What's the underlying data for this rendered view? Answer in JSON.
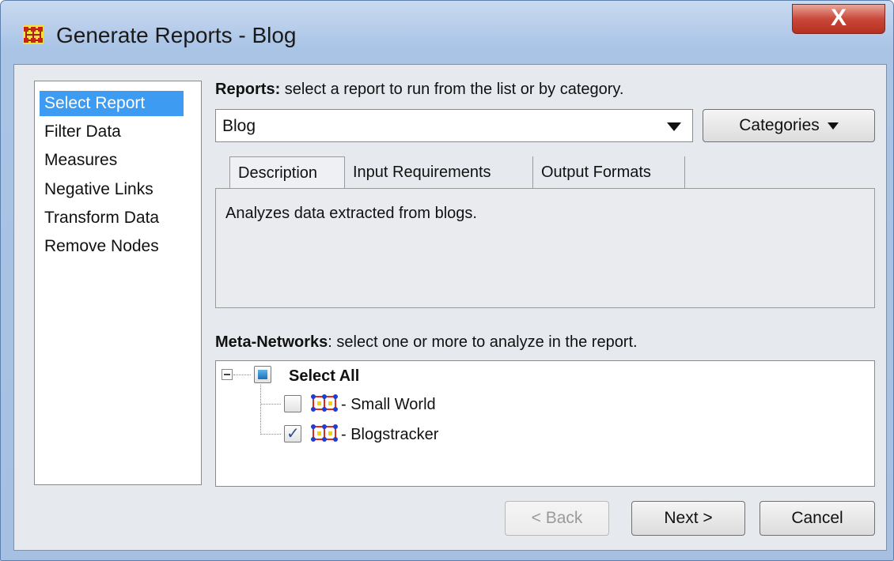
{
  "window": {
    "title": "Generate Reports - Blog",
    "app_icon": "network-grid-icon",
    "close_glyph": "X"
  },
  "nav": {
    "items": [
      {
        "label": "Select Report",
        "selected": true
      },
      {
        "label": "Filter Data",
        "selected": false
      },
      {
        "label": "Measures",
        "selected": false
      },
      {
        "label": "Negative Links",
        "selected": false
      },
      {
        "label": "Transform Data",
        "selected": false
      },
      {
        "label": "Remove Nodes",
        "selected": false
      }
    ]
  },
  "reports": {
    "label_bold": "Reports:",
    "label_rest": " select a report to run from the list or by category.",
    "selected": "Blog",
    "categories_button": "Categories"
  },
  "tabs": {
    "items": [
      {
        "label": "Description",
        "active": true
      },
      {
        "label": "Input Requirements",
        "active": false
      },
      {
        "label": "Output Formats",
        "active": false
      }
    ],
    "description_text": "Analyzes data extracted from blogs."
  },
  "meta_networks": {
    "label_bold": "Meta-Networks",
    "label_rest": ": select one or more to analyze in the report.",
    "select_all": "Select All",
    "items": [
      {
        "label": "- Small World",
        "checked": false
      },
      {
        "label": "- Blogstracker",
        "checked": true
      }
    ]
  },
  "footer": {
    "back": "< Back",
    "next": "Next >",
    "cancel": "Cancel"
  },
  "colors": {
    "selection": "#3d9bf2",
    "title_bar": "#aac4e6",
    "close_button": "#c9483a",
    "node_blue": "#1d3fd1",
    "node_red": "#e0281c",
    "node_yellow": "#f2cf1f"
  }
}
